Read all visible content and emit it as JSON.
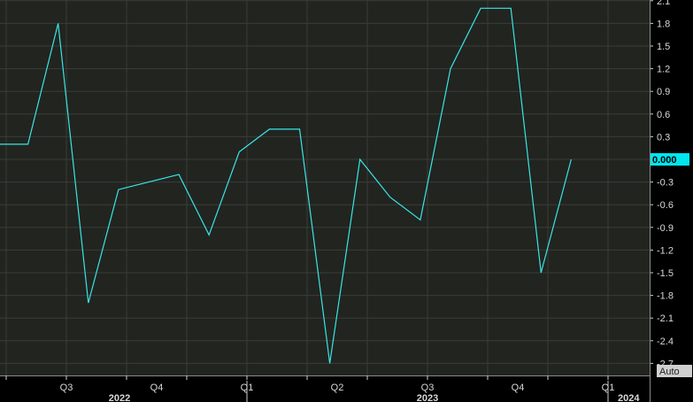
{
  "chart_data": {
    "type": "line",
    "title": "",
    "xlabel": "",
    "ylabel": "",
    "ylim": [
      -2.85,
      2.1
    ],
    "y_ticks": [
      "2.1",
      "1.8",
      "1.5",
      "1.2",
      "0.9",
      "0.6",
      "0.3",
      "0.000",
      "-0.3",
      "-0.6",
      "-0.9",
      "-1.2",
      "-1.5",
      "-1.8",
      "-2.1",
      "-2.4",
      "-2.7"
    ],
    "x_quarter_labels": [
      "Q3",
      "Q4",
      "Q1",
      "Q2",
      "Q3",
      "Q4",
      "Q1"
    ],
    "x_year_labels": [
      "2022",
      "2023",
      "2024"
    ],
    "last_value_label": "0.000",
    "grid": true,
    "colors": {
      "background": "#222420",
      "line": "#38e6e6",
      "grid": "#3a3c38",
      "last_value_bg": "#00e5ee",
      "auto_button": "#d0d0d0"
    },
    "series": [
      {
        "values": [
          0.2,
          0.2,
          1.8,
          -1.9,
          -0.4,
          -0.3,
          -0.2,
          -1.0,
          0.1,
          0.4,
          0.4,
          -2.7,
          0.0,
          -0.5,
          -0.8,
          1.2,
          2.0,
          2.0,
          -1.5,
          0.0
        ]
      }
    ]
  },
  "controls": {
    "auto_label": "Auto"
  }
}
